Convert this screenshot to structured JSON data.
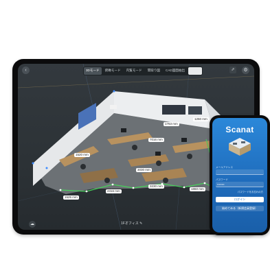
{
  "tablet": {
    "mode_tabs": [
      {
        "label": "3Dモード",
        "active": true
      },
      {
        "label": "俯瞰モード",
        "active": false
      },
      {
        "label": "内覧モード",
        "active": false
      },
      {
        "label": "間取り図",
        "active": false
      },
      {
        "label": "CAD図面抽出",
        "active": false
      },
      {
        "label": "",
        "active": false
      }
    ],
    "back_icon": "chevron-left-icon",
    "share_icon": "share-icon",
    "settings_icon": "gear-icon",
    "cloud_icon": "cloud-icon",
    "floor_label": "1Fオフィス",
    "edit_icon": "pencil-icon",
    "measurements": [
      "1763 mm",
      "1250 mm",
      "7016 mm",
      "1520 mm",
      "1525 mm",
      "2316 mm",
      "3230 mm",
      "1860 mm",
      "3030 mm"
    ],
    "colors": {
      "measure_line": "#46d35a",
      "wall": "#e9ebee",
      "floor": "#6f7478"
    }
  },
  "phone": {
    "app_name": "Scanat",
    "email_label": "メールアドレス",
    "password_label": "パスワード",
    "password_value": "••••••••",
    "forgot_link": "パスワードをお忘れの方",
    "login_button": "ログイン",
    "trial_button": "始めてみる（新規会員登録）",
    "colors": {
      "bg_top": "#2b88d9",
      "bg_bottom": "#1a5fa9"
    }
  }
}
